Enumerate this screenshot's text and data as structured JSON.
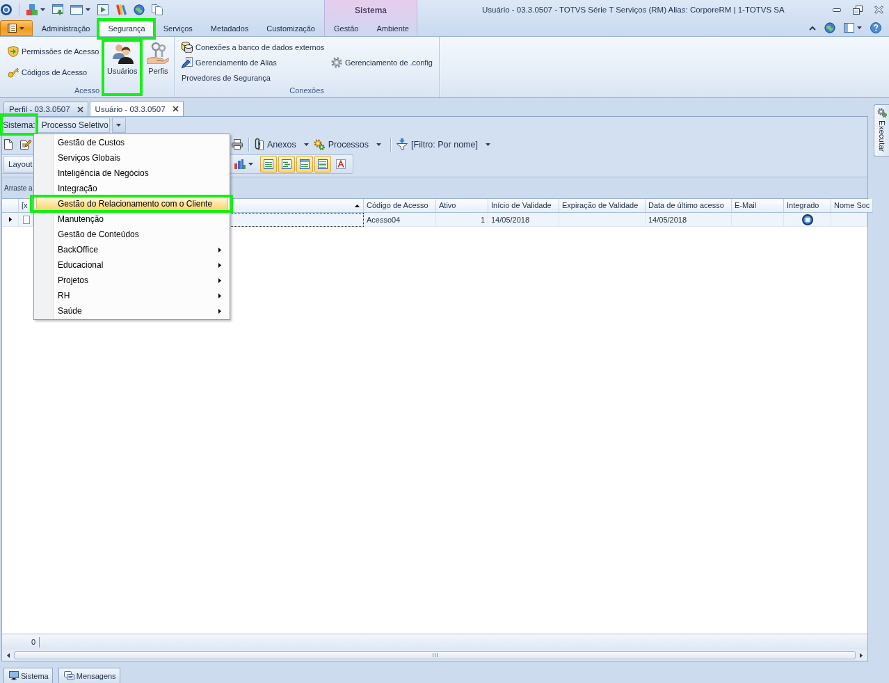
{
  "window": {
    "title": "Usuário - 03.3.0507 - TOTVS Série T Serviços (RM) Alias: CorporeRM | 1-TOTVS SA"
  },
  "ribbon": {
    "tabs": [
      {
        "label": "Administração",
        "selected": false,
        "highlighted": false
      },
      {
        "label": "Segurança",
        "selected": true,
        "highlighted": true
      },
      {
        "label": "Serviços",
        "selected": false,
        "highlighted": false
      },
      {
        "label": "Metadados",
        "selected": false,
        "highlighted": false
      },
      {
        "label": "Customização",
        "selected": false,
        "highlighted": false
      }
    ],
    "contextual_group": {
      "label": "Sistema",
      "tabs": [
        {
          "label": "Gestão",
          "selected": false,
          "highlighted": false
        },
        {
          "label": "Ambiente",
          "selected": false,
          "highlighted": false
        }
      ]
    },
    "groups": [
      {
        "label": "Acesso",
        "items": [
          {
            "kind": "small",
            "label": "Permissões de Acesso",
            "highlighted": false
          },
          {
            "kind": "small",
            "label": "Códigos de Acesso",
            "highlighted": false
          },
          {
            "kind": "large",
            "label": "Usuários",
            "highlighted": true
          },
          {
            "kind": "large",
            "label": "Perfis",
            "highlighted": false
          }
        ]
      },
      {
        "label": "Conexões",
        "items": [
          {
            "kind": "small",
            "label": "Conexões a banco de dados externos",
            "highlighted": false
          },
          {
            "kind": "small",
            "label": "Gerenciamento de Alias",
            "highlighted": false
          },
          {
            "kind": "small",
            "label": "Provedores de Segurança",
            "highlighted": false
          },
          {
            "kind": "small",
            "label": "Gerenciamento de .config",
            "highlighted": false
          }
        ]
      }
    ]
  },
  "documents": {
    "tabs": [
      {
        "label": "Perfil - 03.3.0507",
        "selected": false
      },
      {
        "label": "Usuário - 03.3.0507",
        "selected": true
      }
    ]
  },
  "side_panel": {
    "label": "Executar"
  },
  "sistema": {
    "label": "Sistema:",
    "highlighted": true,
    "value": "Processo Seletivo",
    "expanded": true
  },
  "toolbar": {
    "items": [
      {
        "label": "Anexos"
      },
      {
        "label": "Processos"
      },
      {
        "label": "[Filtro: Por nome]"
      }
    ]
  },
  "view_toolbar": {
    "layout": "Layout",
    "toggles": [
      {
        "on": true
      },
      {
        "on": true
      },
      {
        "on": true
      },
      {
        "on": true
      },
      {
        "on": false
      }
    ]
  },
  "group_panel": {
    "hint": "Arraste a"
  },
  "table": {
    "columns": [
      {
        "kind": "check",
        "label": "[x"
      },
      {
        "kind": "text",
        "sorted": true
      },
      {
        "kind": "text",
        "label": "Código de Acesso"
      },
      {
        "kind": "number",
        "label": "Ativo"
      },
      {
        "kind": "text",
        "label": "Início de Validade"
      },
      {
        "kind": "text",
        "label": "Expiração de Validade"
      },
      {
        "kind": "text",
        "label": "Data de último acesso"
      },
      {
        "kind": "text",
        "label": "E-Mail"
      },
      {
        "kind": "icon",
        "label": "Integrado"
      },
      {
        "kind": "text",
        "label": "Nome Soc"
      }
    ],
    "rows": [
      {
        "selected": true,
        "cells": [
          false,
          null,
          "Acesso04",
          "1",
          "14/05/2018",
          null,
          "14/05/2018",
          null,
          true,
          null
        ]
      }
    ],
    "footer": {
      "count": "0"
    }
  },
  "menu": {
    "items": [
      {
        "label": "Gestão de Custos",
        "selected": false,
        "submenu": false,
        "highlighted": false
      },
      {
        "label": "Serviços Globais",
        "selected": false,
        "submenu": false,
        "highlighted": false
      },
      {
        "label": "Inteligência de Negócios",
        "selected": false,
        "submenu": false,
        "highlighted": false
      },
      {
        "label": "Integração",
        "selected": false,
        "submenu": false,
        "highlighted": false
      },
      {
        "label": "Gestão do Relacionamento com o Cliente",
        "selected": true,
        "submenu": false,
        "highlighted": true
      },
      {
        "label": "Manutenção",
        "selected": false,
        "submenu": false,
        "highlighted": false
      },
      {
        "label": "Gestão de Conteúdos",
        "selected": false,
        "submenu": false,
        "highlighted": false
      },
      {
        "label": "BackOffice",
        "selected": false,
        "submenu": true,
        "highlighted": false
      },
      {
        "label": "Educacional",
        "selected": false,
        "submenu": true,
        "highlighted": false
      },
      {
        "label": "Projetos",
        "selected": false,
        "submenu": true,
        "highlighted": false
      },
      {
        "label": "RH",
        "selected": false,
        "submenu": true,
        "highlighted": false
      },
      {
        "label": "Saúde",
        "selected": false,
        "submenu": true,
        "highlighted": false
      }
    ]
  },
  "bottom_tabs": [
    {
      "label": "Sistema"
    },
    {
      "label": "Mensagens"
    }
  ]
}
